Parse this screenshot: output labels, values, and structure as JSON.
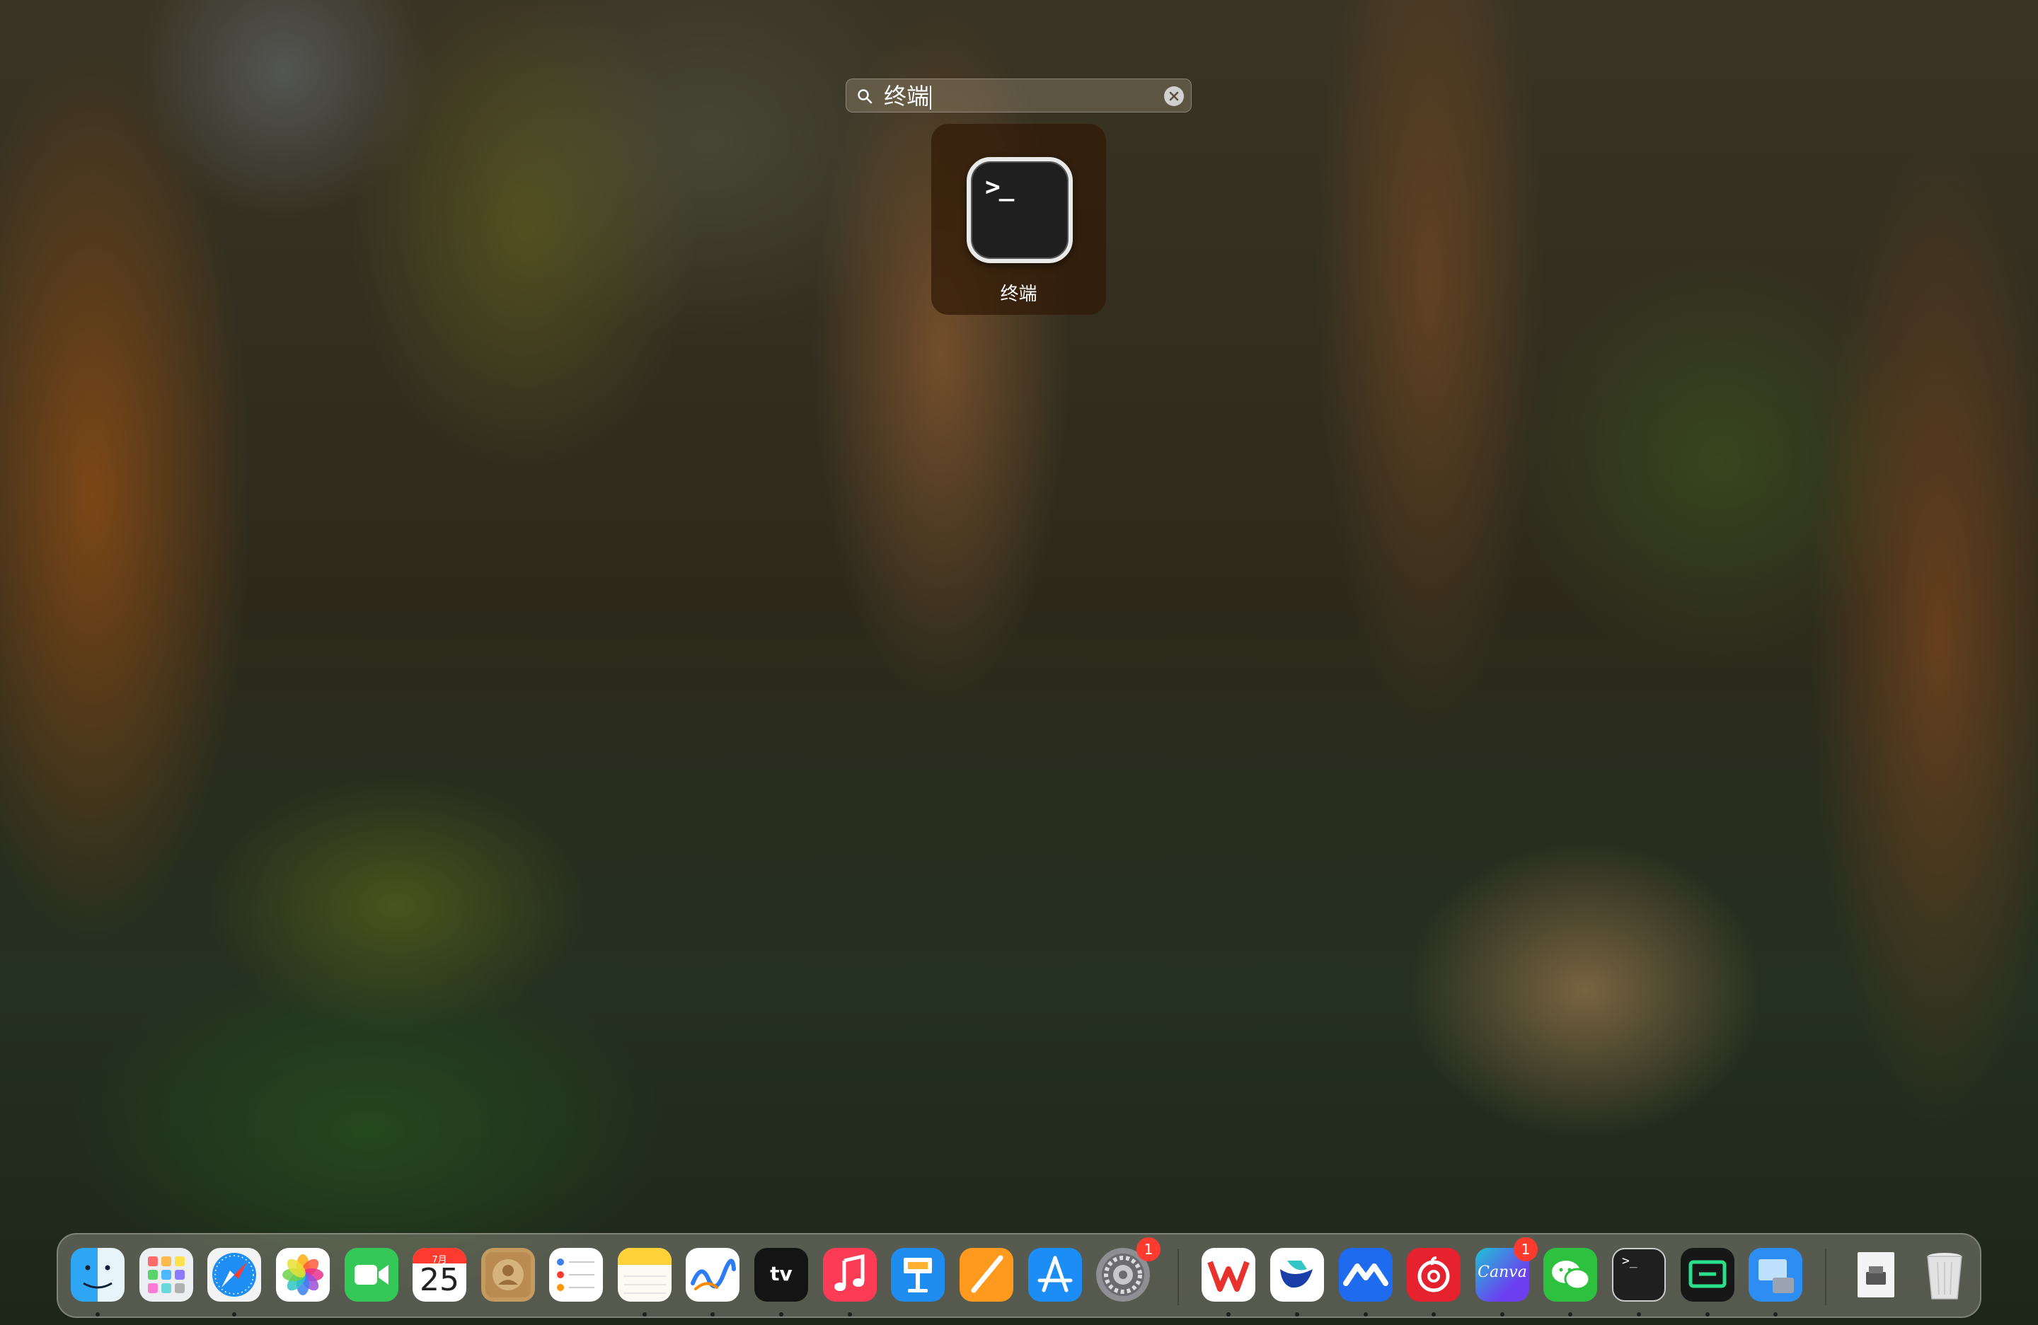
{
  "search": {
    "query": "终端",
    "icon": "magnifying-glass-icon",
    "clear_icon": "clear-x-icon"
  },
  "result": {
    "label": "终端",
    "icon": "terminal-icon",
    "icon_prompt": ">_"
  },
  "dock": {
    "calendar": {
      "month": "7月",
      "day": "25"
    },
    "tv_label": "tv",
    "canva_label": "Canva",
    "terminal_prompt": ">_",
    "settings_badge": "1",
    "canva_badge": "1",
    "items": [
      {
        "name": "finder",
        "icon": "finder-icon",
        "running": true
      },
      {
        "name": "launchpad",
        "icon": "launchpad-icon",
        "running": false
      },
      {
        "name": "safari",
        "icon": "safari-icon",
        "running": true
      },
      {
        "name": "photos",
        "icon": "photos-icon",
        "running": false
      },
      {
        "name": "facetime",
        "icon": "facetime-icon",
        "running": false
      },
      {
        "name": "calendar",
        "icon": "calendar-icon",
        "running": false
      },
      {
        "name": "contacts",
        "icon": "contacts-icon",
        "running": false
      },
      {
        "name": "reminders",
        "icon": "reminders-icon",
        "running": false
      },
      {
        "name": "notes",
        "icon": "notes-icon",
        "running": true
      },
      {
        "name": "freeform",
        "icon": "freeform-icon",
        "running": true
      },
      {
        "name": "apple-tv",
        "icon": "apple-tv-icon",
        "running": true
      },
      {
        "name": "music",
        "icon": "music-icon",
        "running": true
      },
      {
        "name": "keynote",
        "icon": "keynote-icon",
        "running": false
      },
      {
        "name": "pages",
        "icon": "pages-icon",
        "running": false
      },
      {
        "name": "app-store",
        "icon": "app-store-icon",
        "running": false
      },
      {
        "name": "system-settings",
        "icon": "gear-icon",
        "running": false
      },
      {
        "name": "wps-office",
        "icon": "wps-icon",
        "running": true
      },
      {
        "name": "feishu",
        "icon": "feishu-icon",
        "running": true
      },
      {
        "name": "lanhu",
        "icon": "lanhu-icon",
        "running": true
      },
      {
        "name": "netease-music",
        "icon": "netease-music-icon",
        "running": true
      },
      {
        "name": "canva",
        "icon": "canva-icon",
        "running": true
      },
      {
        "name": "wechat",
        "icon": "wechat-icon",
        "running": true
      },
      {
        "name": "terminal",
        "icon": "terminal-icon",
        "running": true
      },
      {
        "name": "screen-tool",
        "icon": "screen-tool-icon",
        "running": true
      },
      {
        "name": "migration-assistant",
        "icon": "migration-icon",
        "running": true
      },
      {
        "name": "document",
        "icon": "document-icon",
        "running": false
      },
      {
        "name": "trash",
        "icon": "trash-icon",
        "running": false
      }
    ]
  }
}
